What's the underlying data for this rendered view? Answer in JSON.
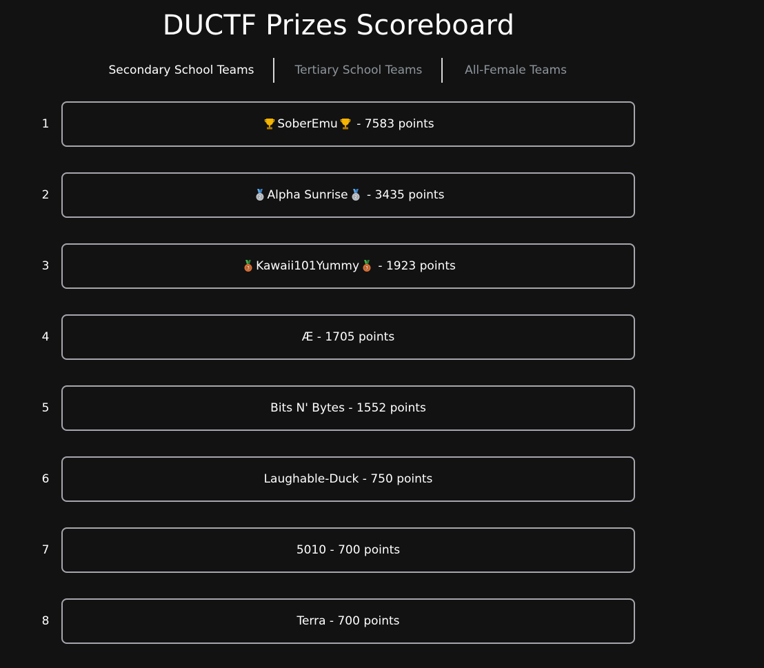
{
  "title": "DUCTF Prizes Scoreboard",
  "tabs": [
    {
      "label": "Secondary School Teams",
      "active": true
    },
    {
      "label": "Tertiary School Teams",
      "active": false
    },
    {
      "label": "All-Female Teams",
      "active": false
    }
  ],
  "teams": [
    {
      "rank": "1",
      "name": "SoberEmu",
      "points": "7583 points",
      "icon": "trophy-icon"
    },
    {
      "rank": "2",
      "name": "Alpha Sunrise",
      "points": "3435 points",
      "icon": "silver-medal-icon"
    },
    {
      "rank": "3",
      "name": "Kawaii101Yummy",
      "points": "1923 points",
      "icon": "bronze-medal-icon"
    },
    {
      "rank": "4",
      "name": "Æ",
      "points": "1705 points",
      "icon": ""
    },
    {
      "rank": "5",
      "name": "Bits N' Bytes",
      "points": "1552 points",
      "icon": ""
    },
    {
      "rank": "6",
      "name": "Laughable-Duck",
      "points": "750 points",
      "icon": ""
    },
    {
      "rank": "7",
      "name": "5010",
      "points": "700 points",
      "icon": ""
    },
    {
      "rank": "8",
      "name": "Terra",
      "points": "700 points",
      "icon": ""
    }
  ],
  "separator": " - ",
  "colors": {
    "background": "#121212",
    "card_border": "#a6a6ae",
    "inactive_tab": "#8e959c",
    "gold": "#f5b400",
    "silver": "#c0c4c8",
    "bronze": "#d9733b",
    "ribbon": "#5aa9e6"
  }
}
